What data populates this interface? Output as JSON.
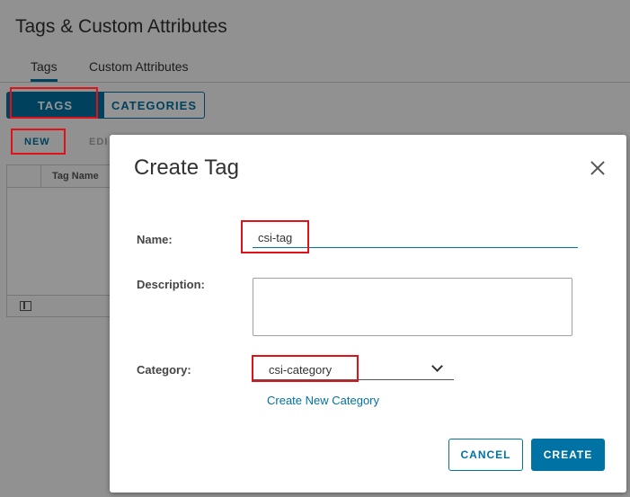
{
  "page": {
    "title": "Tags & Custom Attributes",
    "tabs": [
      {
        "label": "Tags",
        "active": true
      },
      {
        "label": "Custom Attributes",
        "active": false
      }
    ],
    "segment": {
      "tags_label": "TAGS",
      "categories_label": "CATEGORIES",
      "selected": "TAGS"
    },
    "actions": {
      "new_label": "NEW",
      "edit_label": "EDI"
    },
    "grid": {
      "columns": [
        "Tag Name"
      ],
      "footer_icon": "column-toggle-icon"
    }
  },
  "dialog": {
    "title": "Create Tag",
    "close_icon": "close-icon",
    "fields": {
      "name_label": "Name:",
      "name_value": "csi-tag",
      "description_label": "Description:",
      "description_value": "",
      "category_label": "Category:",
      "category_value": "csi-category",
      "category_icon": "chevron-down-icon"
    },
    "create_category_link": "Create New Category",
    "buttons": {
      "cancel": "CANCEL",
      "create": "CREATE"
    }
  },
  "colors": {
    "accent": "#0072a3",
    "highlight": "#e1111a",
    "overlay": "rgba(0,0,0,0.42)"
  }
}
